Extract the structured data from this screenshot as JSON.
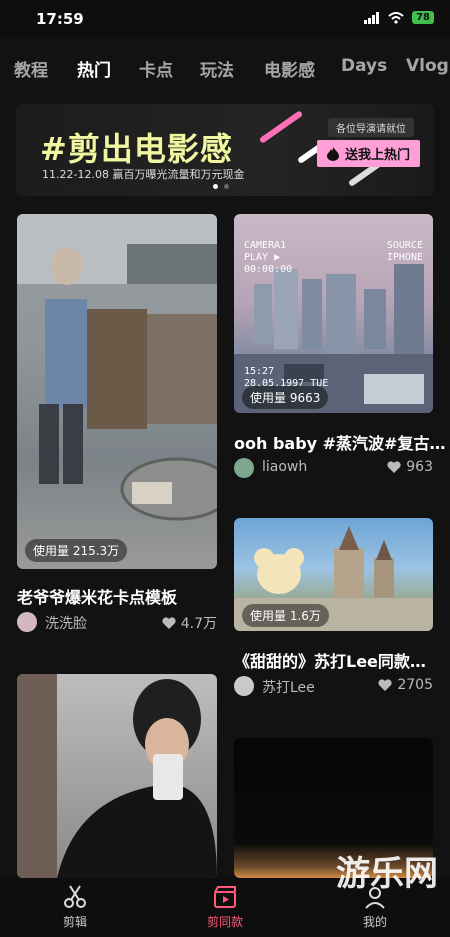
{
  "status": {
    "time": "17:59",
    "battery": "78"
  },
  "tabs": [
    "教程",
    "热门",
    "卡点",
    "玩法",
    "电影感",
    "Days",
    "Vlog"
  ],
  "banner": {
    "title": "#剪出电影感",
    "subtitle": "11.22-12.08 赢百万曝光流量和万元现金",
    "tag": "各位导演请就位",
    "button": "送我上热门"
  },
  "cards": [
    {
      "usage": "使用量 215.3万",
      "title": "老爷爷爆米花卡点模板",
      "author": "洗洗脸",
      "likes": "4.7万"
    },
    {
      "usage": "使用量 9663",
      "title": "ooh baby #蒸汽波#复古…",
      "author": "liaowh",
      "likes": "963",
      "overlay": {
        "camera": "CAMERA1",
        "play": "PLAY ▶",
        "counter": "00:00:00",
        "source": "SOURCE",
        "iphone": "IPHONE",
        "time": "15:27",
        "date": "28.05.1997 TUE"
      }
    },
    {
      "usage": "使用量 1.6万",
      "title": "《甜甜的》苏打Lee同款…",
      "author": "苏打Lee",
      "likes": "2705"
    }
  ],
  "nav": {
    "edit": "剪辑",
    "template": "剪同款",
    "me": "我的"
  },
  "watermark": "游乐网",
  "colors": {
    "accent": "#ff5a7a",
    "banner_title": "#f0f7a0",
    "banner_button": "#ff9fd6"
  }
}
